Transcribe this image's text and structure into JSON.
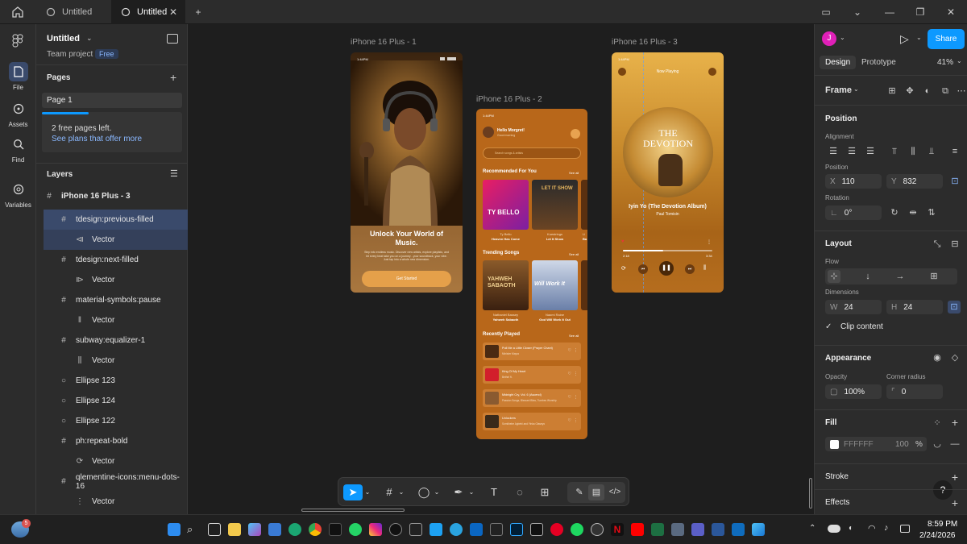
{
  "tabs": [
    {
      "label": "Untitled"
    },
    {
      "label": "Untitled"
    }
  ],
  "rail": {
    "items": [
      {
        "label": "File"
      },
      {
        "label": "Assets"
      },
      {
        "label": "Find"
      },
      {
        "label": "Variables"
      }
    ]
  },
  "file": {
    "title": "Untitled",
    "team": "Team project",
    "plan_badge": "Free"
  },
  "pages": {
    "heading": "Pages",
    "items": [
      {
        "label": "Page 1"
      }
    ],
    "notice": "2 free pages left.",
    "notice_link": "See plans that offer more"
  },
  "layers": {
    "heading": "Layers",
    "items": [
      {
        "label": "iPhone 16 Plus - 3"
      },
      {
        "label": "tdesign:previous-filled"
      },
      {
        "label": "Vector"
      },
      {
        "label": "tdesign:next-filled"
      },
      {
        "label": "Vector"
      },
      {
        "label": "material-symbols:pause"
      },
      {
        "label": "Vector"
      },
      {
        "label": "subway:equalizer-1"
      },
      {
        "label": "Vector"
      },
      {
        "label": "Ellipse 123"
      },
      {
        "label": "Ellipse 124"
      },
      {
        "label": "Ellipse 122"
      },
      {
        "label": "ph:repeat-bold"
      },
      {
        "label": "Vector"
      },
      {
        "label": "qlementine-icons:menu-dots-16"
      },
      {
        "label": "Vector"
      }
    ]
  },
  "frames": {
    "f1": {
      "label": "iPhone 16 Plus - 1",
      "time": "1:44PM",
      "headline": "Unlock Your World of Music.",
      "body": "Step into endless music. Discover new artists, explore playlists, and let every beat take you on a journey - your soundtrack, your vibe. Just tap into a whole new dimension.",
      "cta": "Get Started"
    },
    "f2": {
      "label": "iPhone 16 Plus - 2",
      "time": "1:44PM",
      "greeting": "Hello Morgret!",
      "greeting_sub": "Good morning",
      "search_placeholder": "Search songs & artists",
      "recommended": "Recommended For You",
      "see_all": "See all",
      "rec_items": [
        {
          "cover": "TY BELLO",
          "artist": "Ty Bello",
          "song": "Heaven Has Come"
        },
        {
          "cover": "LET IT SHOW",
          "artist": "Koestrings",
          "song": "Let It Show"
        },
        {
          "cover": "",
          "artist": "Li",
          "song": "Ba"
        }
      ],
      "trending": "Trending Songs",
      "trend_items": [
        {
          "cover": "YAHWEH SABAOTH",
          "artist": "Nathaniel Bassey",
          "song": "Yahweh Sabaoth"
        },
        {
          "cover": "Will Work It",
          "artist": "Naomi Raine",
          "song": "God Will Work It Out"
        }
      ],
      "recent": "Recently Played",
      "recent_items": [
        {
          "title": "Pull Me a Little Closer (Prayer Chant)",
          "artist": "Minister Mayra"
        },
        {
          "title": "King Of My Heart",
          "artist": "Bethel ft."
        },
        {
          "title": "Midnight Cry, Vol. 6 (Ascend)",
          "artist": "Passion Songs, Blessed Bliss, Tumbes Worship"
        },
        {
          "title": "Unlockers",
          "artist": "Somiibebe Agbebi and Yinka Olaseyo"
        }
      ]
    },
    "f3": {
      "label": "iPhone 16 Plus - 3",
      "time": "1:44PM",
      "header": "Now Playing",
      "cover_title": "THE DEVOTION",
      "song": "Iyin Yo (The Devotion Album)",
      "artist": "Paul Tomisin",
      "elapsed": "2:18",
      "total": "3:34",
      "progress": 0.45
    }
  },
  "right": {
    "tabs": [
      {
        "label": "Design"
      },
      {
        "label": "Prototype"
      }
    ],
    "zoom": "41%",
    "share": "Share",
    "avatar": "J",
    "frame_label": "Frame",
    "position": {
      "heading": "Position",
      "alignment": "Alignment",
      "position_label": "Position",
      "x_label": "X",
      "x": "110",
      "y_label": "Y",
      "y": "832",
      "rotation_label": "Rotation",
      "rotation": "0°"
    },
    "layout": {
      "heading": "Layout",
      "flow": "Flow",
      "dimensions": "Dimensions",
      "w_label": "W",
      "w": "24",
      "h_label": "H",
      "h": "24",
      "clip": "Clip content"
    },
    "appearance": {
      "heading": "Appearance",
      "opacity_label": "Opacity",
      "opacity": "100%",
      "radius_label": "Corner radius",
      "radius": "0"
    },
    "fill": {
      "heading": "Fill",
      "hex": "FFFFFF",
      "opacity": "100",
      "pct": "%"
    },
    "stroke": {
      "heading": "Stroke"
    },
    "effects": {
      "heading": "Effects"
    },
    "help": "?"
  },
  "taskbar": {
    "time": "8:59 PM",
    "date": "2/24/2026",
    "badge": "5"
  },
  "colors": {
    "accent": "#0d99ff",
    "selection": "#3a4a6b",
    "orange": "#c0741e"
  }
}
